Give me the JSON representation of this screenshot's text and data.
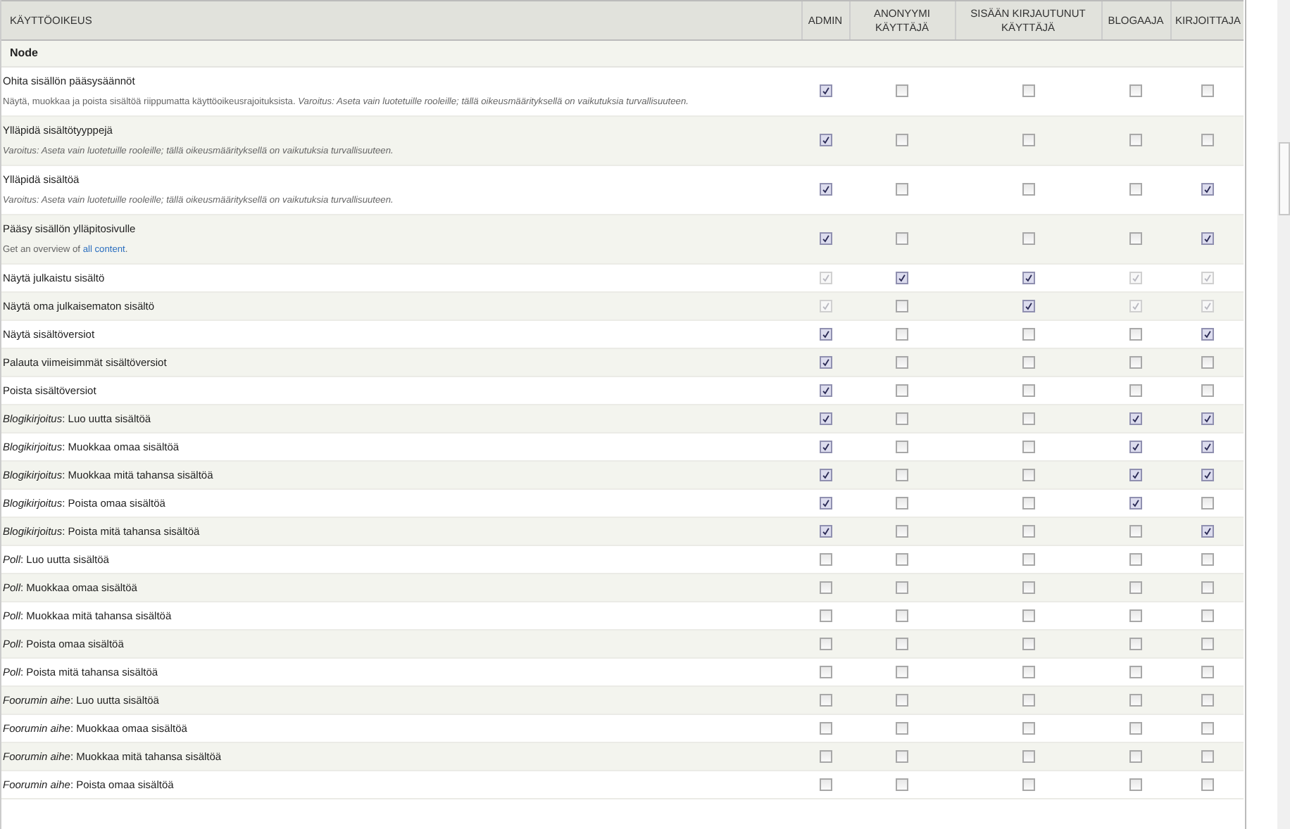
{
  "table": {
    "columns": [
      {
        "label": "KÄYTTÖOIKEUS"
      },
      {
        "label": "ADMIN"
      },
      {
        "label": "ANONYYMI KÄYTTÄJÄ"
      },
      {
        "label": "SISÄÄN KIRJAUTUNUT KÄYTTÄJÄ"
      },
      {
        "label": "BLOGAAJA"
      },
      {
        "label": "KIRJOITTAJA"
      }
    ],
    "group": "Node",
    "rows": [
      {
        "name": "Ohita sisällön pääsysäännöt",
        "description": [
          {
            "kind": "text",
            "text": "Näytä, muokkaa ja poista sisältöä riippumatta käyttöoikeusrajoituksista. *Varoitus: Aseta vain luotetuille rooleille; tällä oikeusmäärityksellä on vaikutuksia turvallisuuteen.*"
          }
        ],
        "cells": [
          {
            "checked": true,
            "disabled": false
          },
          {
            "checked": false,
            "disabled": false
          },
          {
            "checked": false,
            "disabled": false
          },
          {
            "checked": false,
            "disabled": false
          },
          {
            "checked": false,
            "disabled": false
          }
        ]
      },
      {
        "name": "Ylläpidä sisältötyyppejä",
        "description": [
          {
            "kind": "text",
            "text": "*Varoitus: Aseta vain luotetuille rooleille; tällä oikeusmäärityksellä on vaikutuksia turvallisuuteen.*"
          }
        ],
        "cells": [
          {
            "checked": true,
            "disabled": false
          },
          {
            "checked": false,
            "disabled": false
          },
          {
            "checked": false,
            "disabled": false
          },
          {
            "checked": false,
            "disabled": false
          },
          {
            "checked": false,
            "disabled": false
          }
        ]
      },
      {
        "name": "Ylläpidä sisältöä",
        "description": [
          {
            "kind": "text",
            "text": "*Varoitus: Aseta vain luotetuille rooleille; tällä oikeusmäärityksellä on vaikutuksia turvallisuuteen.*"
          }
        ],
        "cells": [
          {
            "checked": true,
            "disabled": false
          },
          {
            "checked": false,
            "disabled": false
          },
          {
            "checked": false,
            "disabled": false
          },
          {
            "checked": false,
            "disabled": false
          },
          {
            "checked": true,
            "disabled": false
          }
        ]
      },
      {
        "name": "Pääsy sisällön ylläpitosivulle",
        "description": [
          {
            "kind": "text",
            "text": "Get an overview of "
          },
          {
            "kind": "link",
            "text": "all content"
          },
          {
            "kind": "text",
            "text": "."
          }
        ],
        "cells": [
          {
            "checked": true,
            "disabled": false
          },
          {
            "checked": false,
            "disabled": false
          },
          {
            "checked": false,
            "disabled": false
          },
          {
            "checked": false,
            "disabled": false
          },
          {
            "checked": true,
            "disabled": false
          }
        ]
      },
      {
        "name": "Näytä julkaistu sisältö",
        "cells": [
          {
            "checked": true,
            "disabled": true
          },
          {
            "checked": true,
            "disabled": false
          },
          {
            "checked": true,
            "disabled": false
          },
          {
            "checked": true,
            "disabled": true
          },
          {
            "checked": true,
            "disabled": true
          }
        ]
      },
      {
        "name": "Näytä oma julkaisematon sisältö",
        "cells": [
          {
            "checked": true,
            "disabled": true
          },
          {
            "checked": false,
            "disabled": false
          },
          {
            "checked": true,
            "disabled": false
          },
          {
            "checked": true,
            "disabled": true
          },
          {
            "checked": true,
            "disabled": true
          }
        ]
      },
      {
        "name": "Näytä sisältöversiot",
        "cells": [
          {
            "checked": true,
            "disabled": false
          },
          {
            "checked": false,
            "disabled": false
          },
          {
            "checked": false,
            "disabled": false
          },
          {
            "checked": false,
            "disabled": false
          },
          {
            "checked": true,
            "disabled": false
          }
        ]
      },
      {
        "name": "Palauta viimeisimmät sisältöversiot",
        "cells": [
          {
            "checked": true,
            "disabled": false
          },
          {
            "checked": false,
            "disabled": false
          },
          {
            "checked": false,
            "disabled": false
          },
          {
            "checked": false,
            "disabled": false
          },
          {
            "checked": false,
            "disabled": false
          }
        ]
      },
      {
        "name": "Poista sisältöversiot",
        "cells": [
          {
            "checked": true,
            "disabled": false
          },
          {
            "checked": false,
            "disabled": false
          },
          {
            "checked": false,
            "disabled": false
          },
          {
            "checked": false,
            "disabled": false
          },
          {
            "checked": false,
            "disabled": false
          }
        ]
      },
      {
        "name": "*Blogikirjoitus*: Luo uutta sisältöä",
        "cells": [
          {
            "checked": true,
            "disabled": false
          },
          {
            "checked": false,
            "disabled": false
          },
          {
            "checked": false,
            "disabled": false
          },
          {
            "checked": true,
            "disabled": false
          },
          {
            "checked": true,
            "disabled": false
          }
        ]
      },
      {
        "name": "*Blogikirjoitus*: Muokkaa omaa sisältöä",
        "cells": [
          {
            "checked": true,
            "disabled": false
          },
          {
            "checked": false,
            "disabled": false
          },
          {
            "checked": false,
            "disabled": false
          },
          {
            "checked": true,
            "disabled": false
          },
          {
            "checked": true,
            "disabled": false
          }
        ]
      },
      {
        "name": "*Blogikirjoitus*: Muokkaa mitä tahansa sisältöä",
        "cells": [
          {
            "checked": true,
            "disabled": false
          },
          {
            "checked": false,
            "disabled": false
          },
          {
            "checked": false,
            "disabled": false
          },
          {
            "checked": true,
            "disabled": false
          },
          {
            "checked": true,
            "disabled": false
          }
        ]
      },
      {
        "name": "*Blogikirjoitus*: Poista omaa sisältöä",
        "cells": [
          {
            "checked": true,
            "disabled": false
          },
          {
            "checked": false,
            "disabled": false
          },
          {
            "checked": false,
            "disabled": false
          },
          {
            "checked": true,
            "disabled": false
          },
          {
            "checked": false,
            "disabled": false
          }
        ]
      },
      {
        "name": "*Blogikirjoitus*: Poista mitä tahansa sisältöä",
        "cells": [
          {
            "checked": true,
            "disabled": false
          },
          {
            "checked": false,
            "disabled": false
          },
          {
            "checked": false,
            "disabled": false
          },
          {
            "checked": false,
            "disabled": false
          },
          {
            "checked": true,
            "disabled": false
          }
        ]
      },
      {
        "name": "*Poll*: Luo uutta sisältöä",
        "cells": [
          {
            "checked": false,
            "disabled": false
          },
          {
            "checked": false,
            "disabled": false
          },
          {
            "checked": false,
            "disabled": false
          },
          {
            "checked": false,
            "disabled": false
          },
          {
            "checked": false,
            "disabled": false
          }
        ]
      },
      {
        "name": "*Poll*: Muokkaa omaa sisältöä",
        "cells": [
          {
            "checked": false,
            "disabled": false
          },
          {
            "checked": false,
            "disabled": false
          },
          {
            "checked": false,
            "disabled": false
          },
          {
            "checked": false,
            "disabled": false
          },
          {
            "checked": false,
            "disabled": false
          }
        ]
      },
      {
        "name": "*Poll*: Muokkaa mitä tahansa sisältöä",
        "cells": [
          {
            "checked": false,
            "disabled": false
          },
          {
            "checked": false,
            "disabled": false
          },
          {
            "checked": false,
            "disabled": false
          },
          {
            "checked": false,
            "disabled": false
          },
          {
            "checked": false,
            "disabled": false
          }
        ]
      },
      {
        "name": "*Poll*: Poista omaa sisältöä",
        "cells": [
          {
            "checked": false,
            "disabled": false
          },
          {
            "checked": false,
            "disabled": false
          },
          {
            "checked": false,
            "disabled": false
          },
          {
            "checked": false,
            "disabled": false
          },
          {
            "checked": false,
            "disabled": false
          }
        ]
      },
      {
        "name": "*Poll*: Poista mitä tahansa sisältöä",
        "cells": [
          {
            "checked": false,
            "disabled": false
          },
          {
            "checked": false,
            "disabled": false
          },
          {
            "checked": false,
            "disabled": false
          },
          {
            "checked": false,
            "disabled": false
          },
          {
            "checked": false,
            "disabled": false
          }
        ]
      },
      {
        "name": "*Foorumin aihe*: Luo uutta sisältöä",
        "cells": [
          {
            "checked": false,
            "disabled": false
          },
          {
            "checked": false,
            "disabled": false
          },
          {
            "checked": false,
            "disabled": false
          },
          {
            "checked": false,
            "disabled": false
          },
          {
            "checked": false,
            "disabled": false
          }
        ]
      },
      {
        "name": "*Foorumin aihe*: Muokkaa omaa sisältöä",
        "cells": [
          {
            "checked": false,
            "disabled": false
          },
          {
            "checked": false,
            "disabled": false
          },
          {
            "checked": false,
            "disabled": false
          },
          {
            "checked": false,
            "disabled": false
          },
          {
            "checked": false,
            "disabled": false
          }
        ]
      },
      {
        "name": "*Foorumin aihe*: Muokkaa mitä tahansa sisältöä",
        "cells": [
          {
            "checked": false,
            "disabled": false
          },
          {
            "checked": false,
            "disabled": false
          },
          {
            "checked": false,
            "disabled": false
          },
          {
            "checked": false,
            "disabled": false
          },
          {
            "checked": false,
            "disabled": false
          }
        ]
      },
      {
        "name": "*Foorumin aihe*: Poista omaa sisältöä",
        "cells": [
          {
            "checked": false,
            "disabled": false
          },
          {
            "checked": false,
            "disabled": false
          },
          {
            "checked": false,
            "disabled": false
          },
          {
            "checked": false,
            "disabled": false
          },
          {
            "checked": false,
            "disabled": false
          }
        ]
      }
    ]
  }
}
